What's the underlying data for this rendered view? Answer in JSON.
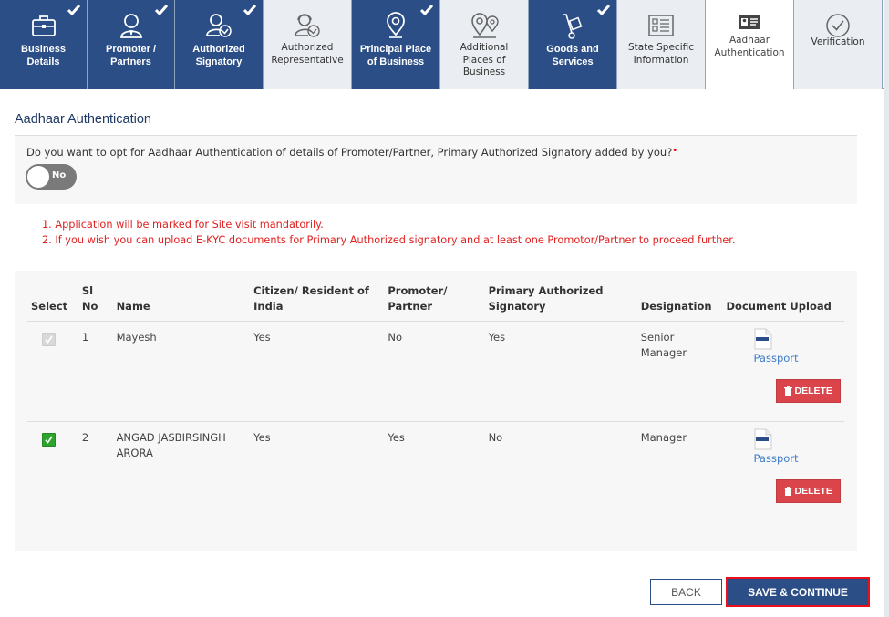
{
  "steps": [
    {
      "label": "Business Details",
      "status": "done",
      "icon": "briefcase-icon"
    },
    {
      "label": "Promoter / Partners",
      "status": "done",
      "icon": "person-icon"
    },
    {
      "label": "Authorized Signatory",
      "status": "done",
      "icon": "person-check-icon"
    },
    {
      "label": "Authorized Representative",
      "status": "pending",
      "icon": "person-headset-check-icon"
    },
    {
      "label": "Principal Place of Business",
      "status": "done",
      "icon": "location-pin-icon"
    },
    {
      "label": "Additional Places of Business",
      "status": "pending",
      "icon": "multiple-pins-icon"
    },
    {
      "label": "Goods and Services",
      "status": "done",
      "icon": "hand-truck-icon"
    },
    {
      "label": "State Specific Information",
      "status": "pending",
      "icon": "info-list-icon"
    },
    {
      "label": "Aadhaar Authentication",
      "status": "active",
      "icon": "id-card-icon"
    },
    {
      "label": "Verification",
      "status": "pending",
      "icon": "check-circle-icon"
    }
  ],
  "section_title": "Aadhaar Authentication",
  "opt_question": "Do you want to opt for Aadhaar Authentication of details of Promoter/Partner, Primary Authorized Signatory added by you?",
  "required_mark": "•",
  "toggle": {
    "label": "No",
    "value": false
  },
  "notes": [
    "1. Application will be marked for Site visit mandatorily.",
    "2. If you wish you can upload E-KYC documents for Primary Authorized signatory and at least one Promotor/Partner to proceed further."
  ],
  "table": {
    "headers": [
      "Select",
      "Sl No",
      "Name",
      "Citizen/ Resident of India",
      "Promoter/ Partner",
      "Primary Authorized Signatory",
      "Designation",
      "Document Upload"
    ],
    "rows": [
      {
        "selected": true,
        "disabled": true,
        "sl": "1",
        "name": "Mayesh",
        "citizen": "Yes",
        "promoter": "No",
        "primary": "Yes",
        "designation": "Senior Manager",
        "document": "Passport",
        "delete_label": "DELETE"
      },
      {
        "selected": true,
        "disabled": false,
        "sl": "2",
        "name": "ANGAD JASBIRSINGH ARORA",
        "citizen": "Yes",
        "promoter": "Yes",
        "primary": "No",
        "designation": "Manager",
        "document": "Passport",
        "delete_label": "DELETE"
      }
    ]
  },
  "buttons": {
    "back": "BACK",
    "save": "SAVE & CONTINUE"
  },
  "colors": {
    "primary": "#2c4e86",
    "danger": "#d9454a",
    "note": "#e02020",
    "checked": "#2ea32e",
    "link": "#3d7cc9"
  }
}
